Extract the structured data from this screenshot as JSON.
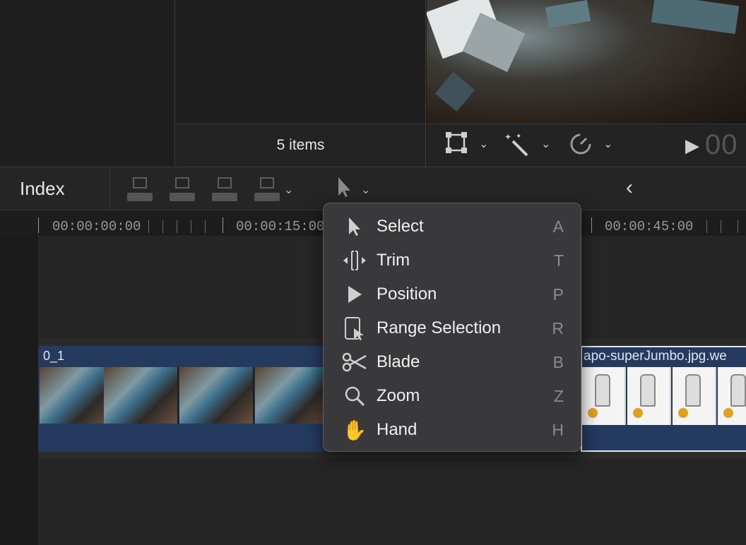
{
  "browser": {
    "item_count": "5 items"
  },
  "viewer": {
    "timecode": "00",
    "tools": [
      {
        "name": "transform-icon"
      },
      {
        "name": "enhance-wand-icon"
      },
      {
        "name": "speed-gauge-icon"
      },
      {
        "name": "play-icon"
      }
    ]
  },
  "timeline_toolbar": {
    "index_label": "Index",
    "edit_buttons": [
      "connect",
      "insert",
      "append",
      "overwrite"
    ],
    "tool_icon": "pointer-icon",
    "nav_back_icon": "chevron-left-icon"
  },
  "ruler": {
    "timecodes": [
      "00:00:00:00",
      "00:00:15:00",
      "00:00:45:00"
    ]
  },
  "clips": [
    {
      "name": "0_1"
    },
    {
      "name": "apo-superJumbo.jpg.we"
    }
  ],
  "tool_menu": {
    "items": [
      {
        "label": "Select",
        "shortcut": "A",
        "icon": "arrow-pointer-icon"
      },
      {
        "label": "Trim",
        "shortcut": "T",
        "icon": "trim-icon"
      },
      {
        "label": "Position",
        "shortcut": "P",
        "icon": "position-pointer-icon"
      },
      {
        "label": "Range Selection",
        "shortcut": "R",
        "icon": "range-selection-icon"
      },
      {
        "label": "Blade",
        "shortcut": "B",
        "icon": "scissors-icon"
      },
      {
        "label": "Zoom",
        "shortcut": "Z",
        "icon": "magnifier-icon"
      },
      {
        "label": "Hand",
        "shortcut": "H",
        "icon": "hand-icon"
      }
    ]
  }
}
